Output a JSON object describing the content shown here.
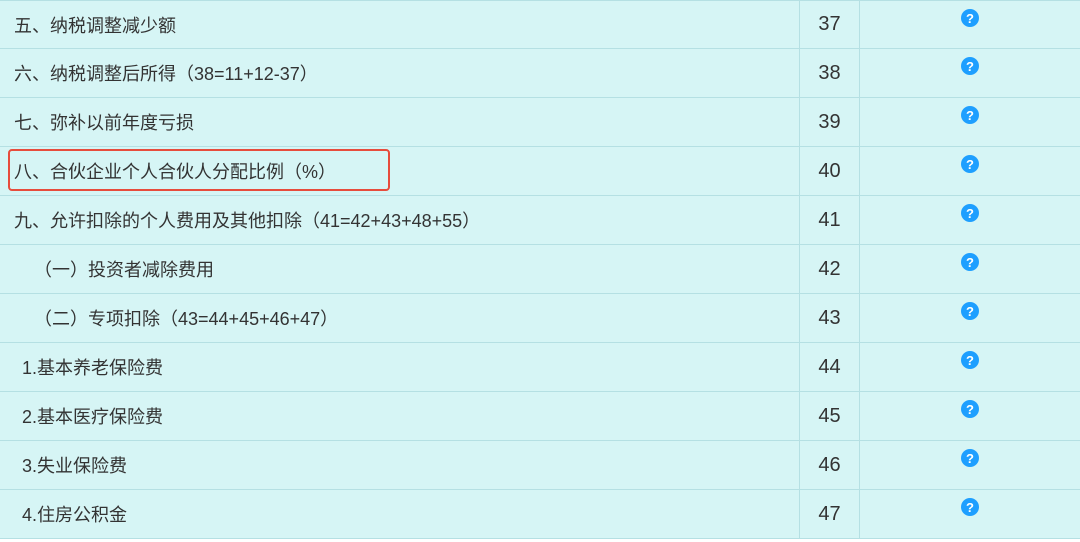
{
  "rows": [
    {
      "label": "五、纳税调整减少额",
      "num": "37",
      "highlight": false,
      "indent": 0
    },
    {
      "label": "六、纳税调整后所得（38=11+12-37）",
      "num": "38",
      "highlight": false,
      "indent": 0
    },
    {
      "label": "七、弥补以前年度亏损",
      "num": "39",
      "highlight": false,
      "indent": 0
    },
    {
      "label": "八、合伙企业个人合伙人分配比例（%）",
      "num": "40",
      "highlight": true,
      "indent": 0
    },
    {
      "label": "九、允许扣除的个人费用及其他扣除（41=42+43+48+55）",
      "num": "41",
      "highlight": false,
      "indent": 0
    },
    {
      "label": "（一）投资者减除费用",
      "num": "42",
      "highlight": false,
      "indent": 1
    },
    {
      "label": "（二）专项扣除（43=44+45+46+47）",
      "num": "43",
      "highlight": false,
      "indent": 1
    },
    {
      "label": "1.基本养老保险费",
      "num": "44",
      "highlight": false,
      "indent": 2
    },
    {
      "label": "2.基本医疗保险费",
      "num": "45",
      "highlight": false,
      "indent": 2
    },
    {
      "label": "3.失业保险费",
      "num": "46",
      "highlight": false,
      "indent": 2
    },
    {
      "label": "4.住房公积金",
      "num": "47",
      "highlight": false,
      "indent": 2
    }
  ],
  "help_icon_glyph": "?"
}
